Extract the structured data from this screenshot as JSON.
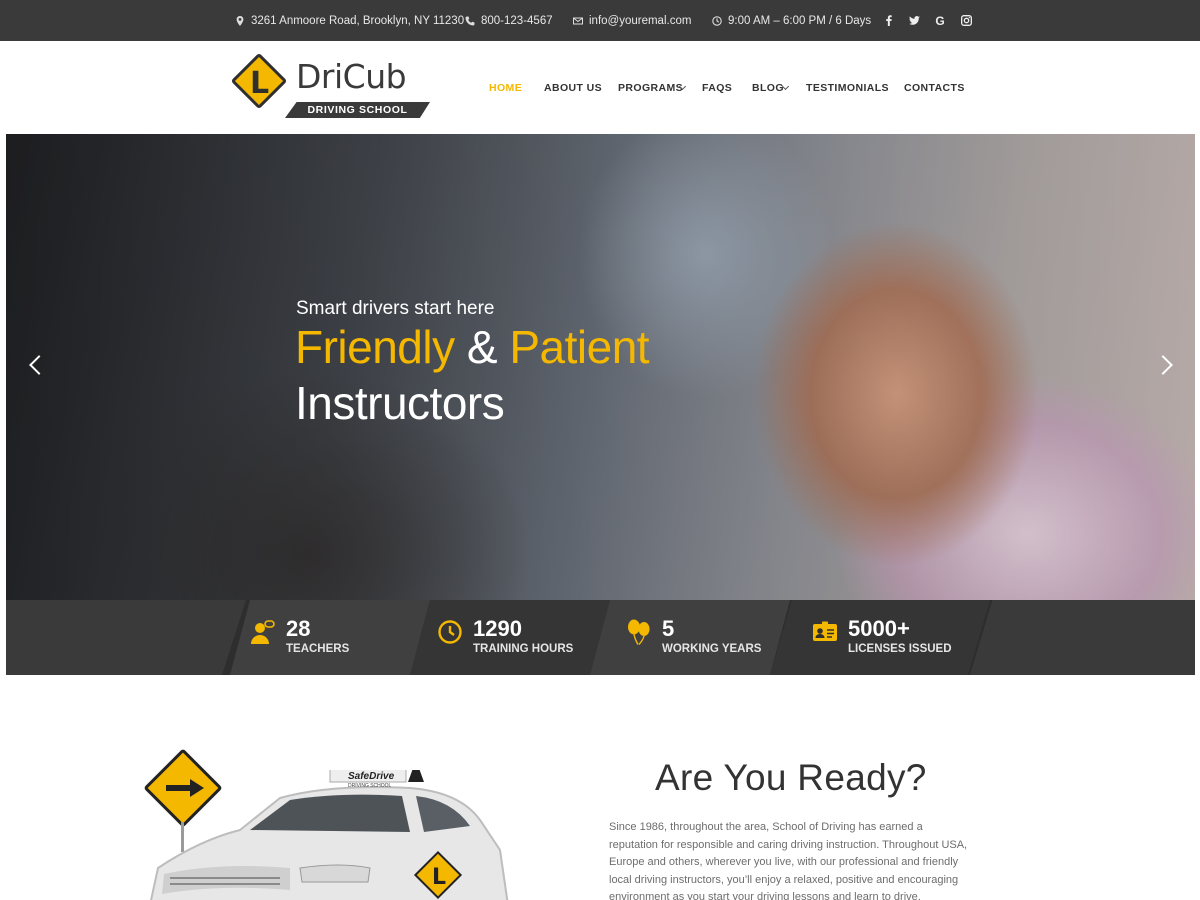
{
  "topbar": {
    "address": "3261 Anmoore Road, Brooklyn, NY 11230",
    "phone": "800-123-4567",
    "email": "info@youremal.com",
    "hours": "9:00 AM – 6:00 PM / 6 Days",
    "social_icons": [
      "facebook-icon",
      "twitter-icon",
      "google-icon",
      "instagram-icon"
    ],
    "google_label": "G"
  },
  "logo": {
    "brand": "DriCub",
    "tagline": "DRIVING SCHOOL",
    "mark_letter": "L"
  },
  "nav": {
    "items": [
      {
        "label": "HOME",
        "active": true
      },
      {
        "label": "ABOUT US"
      },
      {
        "label": "PROGRAMS",
        "dropdown": true
      },
      {
        "label": "FAQS"
      },
      {
        "label": "BLOG",
        "dropdown": true
      },
      {
        "label": "TESTIMONIALS"
      },
      {
        "label": "CONTACTS"
      }
    ]
  },
  "hero": {
    "kicker": "Smart drivers start here",
    "title_part1": "Friendly",
    "title_amp": " & ",
    "title_part2": "Patient",
    "title_line2": "Instructors"
  },
  "stats": [
    {
      "value": "28",
      "label": "TEACHERS",
      "icon": "teacher-icon"
    },
    {
      "value": "1290",
      "label": "TRAINING HOURS",
      "icon": "clock-icon"
    },
    {
      "value": "5",
      "label": "WORKING YEARS",
      "icon": "balloons-icon"
    },
    {
      "value": "5000+",
      "label": "LICENSES ISSUED",
      "icon": "license-card-icon"
    }
  ],
  "about": {
    "heading": "Are You Ready?",
    "text": "Since 1986, throughout the area, School of Driving has earned a reputation for responsible and caring driving instruction. Throughout USA, Europe and others, wherever you live, with our professional and friendly local driving instructors, you’ll enjoy a relaxed, positive and encouraging environment as you start your driving lessons and learn to drive.",
    "car_sign_brand": "SafeDrive",
    "car_sign_sub": "DRIVING SCHOOL"
  },
  "colors": {
    "accent": "#f5b800",
    "dark": "#3a3a3a"
  }
}
